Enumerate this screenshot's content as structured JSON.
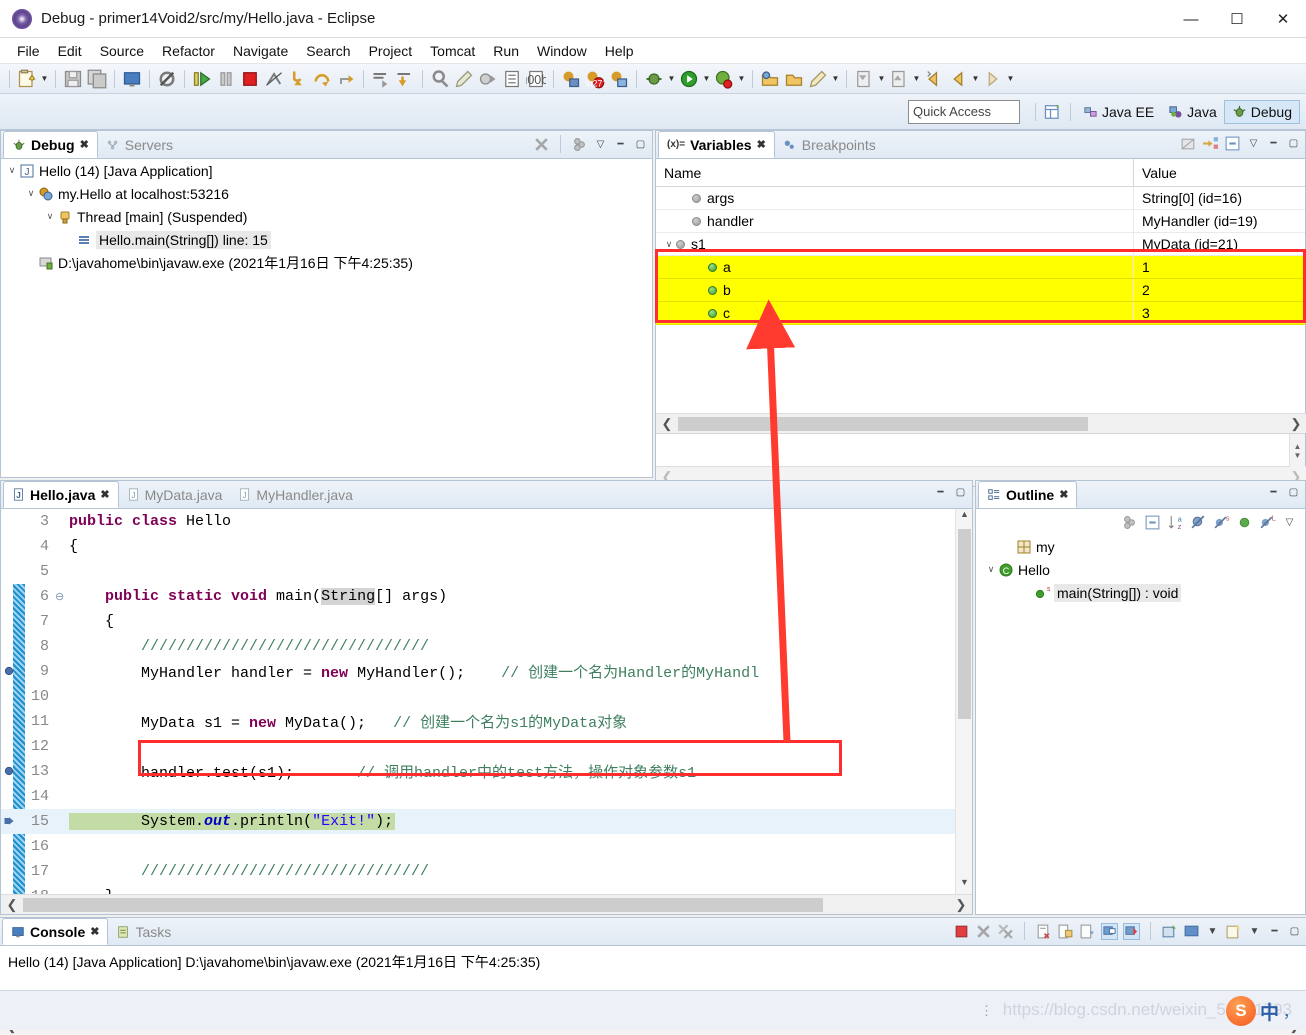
{
  "window": {
    "title": "Debug - primer14Void2/src/my/Hello.java - Eclipse",
    "app_icon": "eclipse-icon",
    "minimize": "—",
    "maximize": "☐",
    "close": "✕"
  },
  "menubar": {
    "items": [
      "File",
      "Edit",
      "Source",
      "Refactor",
      "Navigate",
      "Search",
      "Project",
      "Tomcat",
      "Run",
      "Window",
      "Help"
    ]
  },
  "toolbar2": {
    "quick_access_placeholder": "Quick Access",
    "perspectives": [
      {
        "label": "Java EE",
        "active": false
      },
      {
        "label": "Java",
        "active": false
      },
      {
        "label": "Debug",
        "active": true
      }
    ]
  },
  "debug_view": {
    "tabs": [
      {
        "label": "Debug",
        "selected": true,
        "icon": "debug-icon"
      },
      {
        "label": "Servers",
        "selected": false,
        "icon": "servers-icon"
      }
    ],
    "tree": [
      {
        "indent": 0,
        "twisty": "∨",
        "icon": "launch-icon",
        "label": "Hello (14) [Java Application]",
        "selected": false
      },
      {
        "indent": 1,
        "twisty": "∨",
        "icon": "vm-icon",
        "label": "my.Hello at localhost:53216",
        "selected": false
      },
      {
        "indent": 2,
        "twisty": "∨",
        "icon": "thread-icon",
        "label": "Thread [main] (Suspended)",
        "selected": false
      },
      {
        "indent": 3,
        "twisty": "",
        "icon": "stackframe-icon",
        "label": "Hello.main(String[]) line: 15",
        "selected": true
      },
      {
        "indent": 1,
        "twisty": "",
        "icon": "process-icon",
        "label": "D:\\javahome\\bin\\javaw.exe (2021年1月16日 下午4:25:35)",
        "selected": false
      }
    ]
  },
  "variables_view": {
    "tabs": [
      {
        "label": "Variables",
        "selected": true,
        "icon": "variables-icon"
      },
      {
        "label": "Breakpoints",
        "selected": false,
        "icon": "breakpoints-icon"
      }
    ],
    "columns": [
      "Name",
      "Value"
    ],
    "rows": [
      {
        "indent": 1,
        "twisty": "",
        "dot": "grey",
        "name": "args",
        "value": "String[0]  (id=16)",
        "highlight": false
      },
      {
        "indent": 1,
        "twisty": "",
        "dot": "grey",
        "name": "handler",
        "value": "MyHandler  (id=19)",
        "highlight": false
      },
      {
        "indent": 0,
        "twisty": "∨",
        "dot": "grey",
        "name": "s1",
        "value": "MyData  (id=21)",
        "highlight": false
      },
      {
        "indent": 2,
        "twisty": "",
        "dot": "green",
        "name": "a",
        "value": "1",
        "highlight": true
      },
      {
        "indent": 2,
        "twisty": "",
        "dot": "green",
        "name": "b",
        "value": "2",
        "highlight": true
      },
      {
        "indent": 2,
        "twisty": "",
        "dot": "green",
        "name": "c",
        "value": "3",
        "highlight": true
      }
    ]
  },
  "editor": {
    "tabs": [
      {
        "label": "Hello.java",
        "selected": true
      },
      {
        "label": "MyData.java",
        "selected": false
      },
      {
        "label": "MyHandler.java",
        "selected": false
      }
    ],
    "lines": [
      {
        "num": "3",
        "fold": "",
        "marker": "",
        "html": "<span class=\"kw\">public class</span> Hello"
      },
      {
        "num": "4",
        "fold": "",
        "marker": "",
        "html": "{"
      },
      {
        "num": "5",
        "fold": "",
        "marker": "",
        "html": ""
      },
      {
        "num": "6",
        "fold": "⊖",
        "marker": "",
        "html": "    <span class=\"kw\">public static void</span> main(<span class=\"hlbox\">String</span>[] args)"
      },
      {
        "num": "7",
        "fold": "",
        "marker": "",
        "html": "    {"
      },
      {
        "num": "8",
        "fold": "",
        "marker": "",
        "html": "        <span class=\"cmt\">////////////////////////////////</span>"
      },
      {
        "num": "9",
        "fold": "",
        "marker": "bp",
        "html": "        MyHandler handler = <span class=\"kw\">new</span> MyHandler();    <span class=\"cmt\">// 创建一个名为Handler的MyHandl</span>"
      },
      {
        "num": "10",
        "fold": "",
        "marker": "",
        "html": ""
      },
      {
        "num": "11",
        "fold": "",
        "marker": "",
        "html": "        MyData s1 = <span class=\"kw\">new</span> MyData();   <span class=\"cmt\">// 创建一个名为s1的MyData对象</span>"
      },
      {
        "num": "12",
        "fold": "",
        "marker": "",
        "html": ""
      },
      {
        "num": "13",
        "fold": "",
        "marker": "bp",
        "html": "        handler.test(s1);       <span class=\"cmt\">// 调用handler中的test方法，操作对象参数s1</span>"
      },
      {
        "num": "14",
        "fold": "",
        "marker": "",
        "html": ""
      },
      {
        "num": "15",
        "fold": "",
        "marker": "arrow",
        "html": "        System.<span class=\"fld\">out</span>.println(<span class=\"str\">\"Exit!\"</span>);",
        "exec": true
      },
      {
        "num": "16",
        "fold": "",
        "marker": "",
        "html": ""
      },
      {
        "num": "17",
        "fold": "",
        "marker": "",
        "html": "        <span class=\"cmt\">////////////////////////////////</span>"
      },
      {
        "num": "18",
        "fold": "",
        "marker": "",
        "html": "    }"
      }
    ]
  },
  "outline_view": {
    "tabs": [
      {
        "label": "Outline",
        "selected": true,
        "icon": "outline-icon"
      }
    ],
    "tree": [
      {
        "indent": 1,
        "twisty": "",
        "icon": "package-icon",
        "label": "my",
        "selected": false
      },
      {
        "indent": 0,
        "twisty": "∨",
        "icon": "class-icon",
        "label": "Hello",
        "selected": false
      },
      {
        "indent": 2,
        "twisty": "",
        "icon": "method-static-icon",
        "label": "main(String[]) : void",
        "selected": true
      }
    ]
  },
  "console_view": {
    "tabs": [
      {
        "label": "Console",
        "selected": true,
        "icon": "console-icon"
      },
      {
        "label": "Tasks",
        "selected": false,
        "icon": "tasks-icon"
      }
    ],
    "output": "Hello (14) [Java Application] D:\\javahome\\bin\\javaw.exe (2021年1月16日 下午4:25:35)"
  },
  "statusbar": {
    "watermark": "https://blog.csdn.net/weixin_51481793",
    "ime_logo": "S",
    "ime_mode": "中",
    "ime_punct": "，"
  },
  "annotations": {
    "accent_red": "#ff2d2d",
    "highlight_yellow": "#ffff00",
    "exec_line_green": "#c3dba4",
    "arrow_note": "red-arrow-from-code-line-13-to-variables-a-b-c"
  }
}
